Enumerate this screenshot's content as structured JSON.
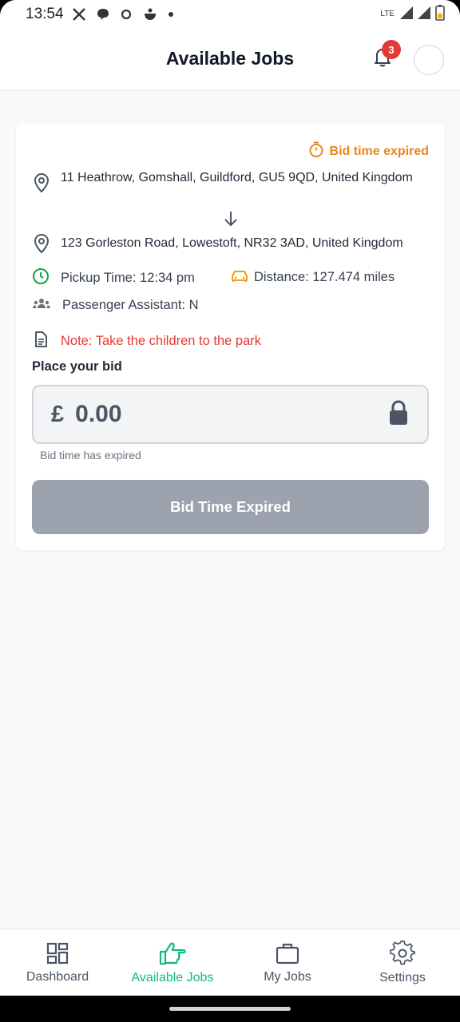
{
  "status_bar": {
    "time": "13:54",
    "network": "LTE",
    "icons": [
      "x-app-icon",
      "chat-bubble-icon",
      "sync-icon",
      "android-app-icon",
      "dot-icon"
    ]
  },
  "header": {
    "title": "Available Jobs",
    "notification_count": "3"
  },
  "job": {
    "status_flag": "Bid time expired",
    "pickup_address": "11 Heathrow, Gomshall, Guildford, GU5 9QD, United Kingdom",
    "dropoff_address": "123 Gorleston Road, Lowestoft, NR32 3AD, United Kingdom",
    "pickup_time": "Pickup Time: 12:34 pm",
    "distance": "Distance: 127.474 miles",
    "passenger_assistant": "Passenger Assistant: N",
    "note": "Note: Take the children to the park",
    "bid_label": "Place your bid",
    "currency": "£",
    "bid_value": "0.00",
    "bid_hint": "Bid time has expired",
    "button_label": "Bid Time Expired"
  },
  "nav": {
    "items": [
      {
        "label": "Dashboard",
        "icon": "dashboard-icon"
      },
      {
        "label": "Available Jobs",
        "icon": "thumb-point-icon"
      },
      {
        "label": "My Jobs",
        "icon": "briefcase-icon"
      },
      {
        "label": "Settings",
        "icon": "gear-icon"
      }
    ]
  },
  "colors": {
    "accent": "#10b981",
    "warning": "#e8871e",
    "danger": "#e53935",
    "disabled": "#9ca3af"
  }
}
